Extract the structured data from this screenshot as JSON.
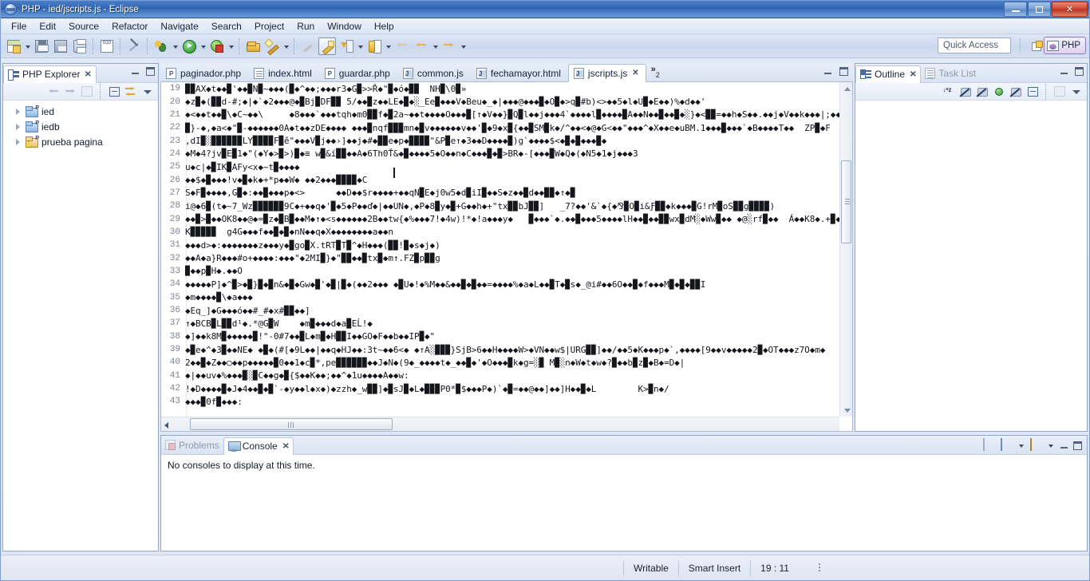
{
  "window": {
    "title": "PHP - ied/jscripts.js - Eclipse",
    "app_icon": "eclipse-icon",
    "minimize_label": "Minimize",
    "restore_label": "Restore",
    "close_label": "Close"
  },
  "menubar": {
    "items": [
      {
        "label": "File",
        "name": "menu-file"
      },
      {
        "label": "Edit",
        "name": "menu-edit"
      },
      {
        "label": "Source",
        "name": "menu-source"
      },
      {
        "label": "Refactor",
        "name": "menu-refactor"
      },
      {
        "label": "Navigate",
        "name": "menu-navigate"
      },
      {
        "label": "Search",
        "name": "menu-search"
      },
      {
        "label": "Project",
        "name": "menu-project"
      },
      {
        "label": "Run",
        "name": "menu-run"
      },
      {
        "label": "Window",
        "name": "menu-window"
      },
      {
        "label": "Help",
        "name": "menu-help"
      }
    ]
  },
  "toolbar": {
    "quick_access_placeholder": "Quick Access",
    "perspective_php_label": "PHP",
    "icons": [
      "new-file-icon",
      "save-icon",
      "save-all-icon",
      "print-icon",
      "binary-icon",
      "no-pen-icon",
      "debug-icon",
      "run-icon",
      "run-error-icon",
      "open-folder-icon",
      "wand-icon",
      "brush-disabled-icon",
      "brush-icon",
      "download-icon",
      "bookmark-icon",
      "back-icon",
      "previous-icon",
      "forward-icon"
    ],
    "new-perspective-icon": "new-perspective-icon"
  },
  "explorer": {
    "tab_label": "PHP Explorer",
    "icon": "php-explorer-icon",
    "toolbar_icons": [
      "back-icon",
      "forward-icon",
      "link-editor-icon",
      "collapse-all-icon",
      "link-with-editor-icon",
      "view-menu-icon"
    ],
    "tree": [
      {
        "label": "ied",
        "icon": "php-project-icon",
        "expanded": false
      },
      {
        "label": "iedb",
        "icon": "php-project-icon",
        "expanded": false
      },
      {
        "label": "prueba pagina",
        "icon": "php-project-warning-icon",
        "expanded": false
      }
    ]
  },
  "editor": {
    "tabs": [
      {
        "label": "paginador.php",
        "icon": "php-file-icon",
        "active": false
      },
      {
        "label": "index.html",
        "icon": "html-file-icon",
        "active": false
      },
      {
        "label": "guardar.php",
        "icon": "php-file-icon",
        "active": false
      },
      {
        "label": "common.js",
        "icon": "js-file-icon",
        "active": false
      },
      {
        "label": "fechamayor.html",
        "icon": "html-file-icon",
        "active": false
      },
      {
        "label": "jscripts.js",
        "icon": "js-file-icon",
        "active": true
      }
    ],
    "overflow_chevron": "»",
    "overflow_count": "2",
    "lines": [
      {
        "no": "19",
        "text": "▉▉AX◆t◆◆▉",
        "blue": "'◆◆▉N▉~◆◆◆(▉◆^◆◆;◆◆◆r3◆G▉>>Ř◆\"▉◆ó◆▉▉  NH▉\\0▉»"
      },
      {
        "no": "20",
        "text": "◆z▉◆(▉▉d-#;◆|◆`◆2◆◆◆@◆▉Bj▉DF▉▉ 5/◆◆▉z◆◆LE◆▉◆░_Ee▉◆◆◆V◆Beu◆_◆|◆◆◆@◆◆◆▉◆O▉◆>q▉#b)<>◆◆5◆l◆U▉◆E◆◆)%◆d◆◆'",
        "blue": ""
      },
      {
        "no": "21",
        "text": "◆<◆◆t◆◆▉\\◆C~◆◆\\     ◆8◆◆◆`◆◆◆tqh◆m0▉▉f◆▉2a~◆◆t◆◆◆◆O◆◆◆▉[↑◆V◆◆}▉Q▉l◆◆j◆◆◆4`◆◆◆◆l▉◆◆◆◆▉A◆◆N◆◆▉◆◆▉◆░}◆<▉▉=◆◆h◆S◆◆.◆◆j◆V◆◆k◆◆◆|;◆◆◆",
        "blue": ""
      },
      {
        "no": "22",
        "text": "▉}-◆,◆a<◆\"▉-◆◆◆◆◆◆0A◆t◆◆zDE◆◆◆◆ ◆◆◆▉nqf▉▉▉mn◆▉v◆◆◆◆◆◆v◆◆'▉◆9◆x▉{◆◆▉SM▉k◆/^◆◆<◆@◆G<◆◆\"◆◆◆^◆X◆◆e◆uBM.1◆◆◆▉◆◆◆`◆B◆◆◆◆T◆◆  ZP▉◆F",
        "blue": ""
      },
      {
        "no": "23",
        "text": ",dI▉░▉▉▉▉▉▉LY▉▉▉▉F▉ě\"◆◆◆V▉j◆◆›]◆◆j◆#◆▉▉e◆p◆▉▉▉▉\"&P▉e↑◆3◆◆D◆◆◆◆▉)g`◆◆◆◆$<◆▉◆▉◆◆◆▉◆",
        "blue": ""
      },
      {
        "no": "24",
        "text": "◆M◆4?jv▉E▉1◆\"(◆Y◆>▉>)▉◆≡ ",
        "blue": "w▉&í▉▉◆◆A◆6Th0Ť&◆▉◆◆◆◆5◆O◆◆n◆C◆◆◆▉◆▉>BR◆-[◆◆◆▉W◆Q◆(◆N5◆1◆j◆◆◆3"
      },
      {
        "no": "25",
        "text": "u◆c|◆▉IK▉AFy<x◆~t▉◆◆◆◆",
        "blue": ""
      },
      {
        "no": "26",
        "text": "◆◆$◆▉◆◆◆!v◆▉◆k◆+*p◆◆W◆ ◆◆2◆◆◆▉▉▉▉◆C",
        "blue": ""
      },
      {
        "no": "27",
        "text": "S◆F▉◆◆◆◆,G▉◆:◆◆▉◆◆◆p◆<>      ◆◆D◆◆$r◆◆◆◆+◆◆qN▉E◆j0w5◆d▉iI▉◆◆S◆z◆◆▉d◆◆▉▉◆↑◆▉",
        "blue": ""
      },
      {
        "no": "28",
        "text": "i@◆6▉(t◆~7_Wz▉▉▉▉▉▉9C◆+◆◆q◆",
        "blue": "'▉◆5◆P◆◆ď◆|◆◆UN◆,◆P◆8▉y◆▉+G◆◆h◆+\"tx▉▉bJ▉▉]   _7?◆◆'&`◆{◆⅋▉O▉i&Ƒ▉▉◆k◆◆◆▉G!rM▉oS▉▉g▉▉▉▉)"
      },
      {
        "no": "29",
        "text": "◆◆▉>▉◆◆OK8◆◆@◆=▉z◆▉B▉◆◆M◆↑◆<s◆◆◆◆◆◆2B◆◆tw{◆%◆◆◆7!◆4w)!*◆!a◆◆◆y◆   ▉◆◆◆`◆.◆◆▉◆◆◆5◆◆◆◆lH◆◆▉◆◆▉▉wx▉dM░◆Ww▉◆◆ ◆@░rf▉◆◆  Á◆◆K8◆.+▉◆",
        "blue": ""
      },
      {
        "no": "30",
        "text": "K▉▉▉▉▉  g4G◆◆◆f◆◆▉◆▉◆nN◆◆q◆X◆◆◆◆◆◆◆◆a◆◆n",
        "blue": ""
      },
      {
        "no": "31",
        "text": "◆◆◆d>◆:◆◆◆◆◆◆◆z◆◆◆y◆▉go▉X.tRT▉T▉^◆H◆◆◆(▉▉!▉◆s◆j◆)",
        "blue": ""
      },
      {
        "no": "32",
        "text": "◆◆A◆a}R◆◆◆#o+◆◆◆◆:◆◆◆\"",
        "blue": "◆2MI▉}◆\"▉▉◆◆▉tx▉◆m↑.FZ▉p▉▉g"
      },
      {
        "no": "33",
        "text": "▉◆◆p▉H◆.◆◆O",
        "blue": ""
      },
      {
        "no": "34",
        "text": "◆◆◆◆◆P]◆^▉>◆▉}▉◆▉n&◆▉◆Gw◆▉'◆▉",
        "blue": "|▉◆(◆◆2◆◆◆ ◆▉U◆!◆%M◆◆&◆◆▉◆▉◆◆=◆◆◆◆%◆a◆L◆◆▉T◆▉s◆_@i#◆◆6O◆◆▉◆f◆◆◆M▉◆▉◆▉▉I"
      },
      {
        "no": "35",
        "text": "◆m◆◆◆◆▉\\◆a◆◆◆",
        "blue": ""
      },
      {
        "no": "36",
        "text": "◆Eq_]◆G◆◆◆ó◆◆#_#◆x#▉▉◆◆]",
        "blue": ""
      },
      {
        "no": "37",
        "text": "↑◆BCB▉L▉▉d¹◆.*@G▉W    ◆m▉◆◆◆d◆a▉EĹ!◆",
        "blue": ""
      },
      {
        "no": "38",
        "text": "◆]◆◆k8M▉◆◆◆◆◆▉!\"-0#7◆◆▉L◆m▉◆H▉▉I◆◆GO◆F◆◆b◆◆IP▉◆\"",
        "blue": ""
      },
      {
        "no": "39",
        "text": "◆▉e◆^◆3▉◆◆NE◆ ◆▉◆(#[◆9L◆◆|◆◆q◆HJ◆◆:3t~◆◆6<◆ ◆↑A░▉▉▉}SjB>6◆◆H◆◆◆◆W>◆VN◆◆w$|URG▉▉]◆◆/◆◆5◆K◆◆◆p◆`,◆◆◆◆[9◆◆v◆◆◆◆◆2▉◆OT◆◆◆z7O◆m◆",
        "blue": ""
      },
      {
        "no": "40",
        "text": "2◆◆▉◆Z◆◆○◆◆p◆◆◆◆◆▉0◆◆1◆c▉*,pe▉▉▉▉▉▉◆◆J◆N◆(9◆_◆◆◆◆t◆_◆◆▉◆",
        "blue": "'◆O◆◆◆▉k◆g=░▉ M▉░n◆W◆t◆w◆?▉◆◆b▉z▉◆B◆=D◆|"
      },
      {
        "no": "41",
        "text": "◆|◆◆uv◆%◆◆◆▉░▉C◆◆g◆▉{$◆◆K◆◆;◆◆^◆1u◆◆◆◆A◆◆w:",
        "blue": ""
      },
      {
        "no": "42",
        "text": "!◆D◆◆◆◆▉◆J◆4◆◆▉◆▉`-◆y◆◆l◆x◆)◆zzh◆_w▉▉]◆▉sJ▉◆L◆▉▉▉P0*▉$◆◆◆P◆)`◆▉=◆◆@◆◆]◆◆]H◆◆▉◆L        K>▉n◆/",
        "blue": ""
      },
      {
        "no": "43",
        "text": "◆◆◆▉0f▉◆◆◆:",
        "blue": ""
      }
    ]
  },
  "outline": {
    "tabs": [
      {
        "label": "Outline",
        "icon": "outline-icon",
        "active": true
      },
      {
        "label": "Task List",
        "icon": "task-list-icon",
        "active": false
      }
    ],
    "toolbar_icons": [
      "sort-az-icon",
      "hide-fields-icon",
      "hide-static-icon",
      "green-dot-icon",
      "hide-local-icon",
      "collapse-all-icon",
      "focus-icon",
      "view-menu-icon"
    ]
  },
  "console": {
    "tabs": [
      {
        "label": "Problems",
        "icon": "problems-icon",
        "active": false
      },
      {
        "label": "Console",
        "icon": "console-icon",
        "active": true
      }
    ],
    "message": "No consoles to display at this time.",
    "toolbar_icons": [
      "open-console-icon",
      "display-console-icon",
      "new-console-icon"
    ]
  },
  "statusbar": {
    "writable": "Writable",
    "insert_mode": "Smart Insert",
    "cursor_position": "19 : 11"
  },
  "colors": {
    "title_blue": "#2f63b0",
    "accent": "#3a35c8",
    "close_red": "#cf4a34",
    "panel_border": "#8fa8cd",
    "chrome_bg": "#dde6f5"
  }
}
